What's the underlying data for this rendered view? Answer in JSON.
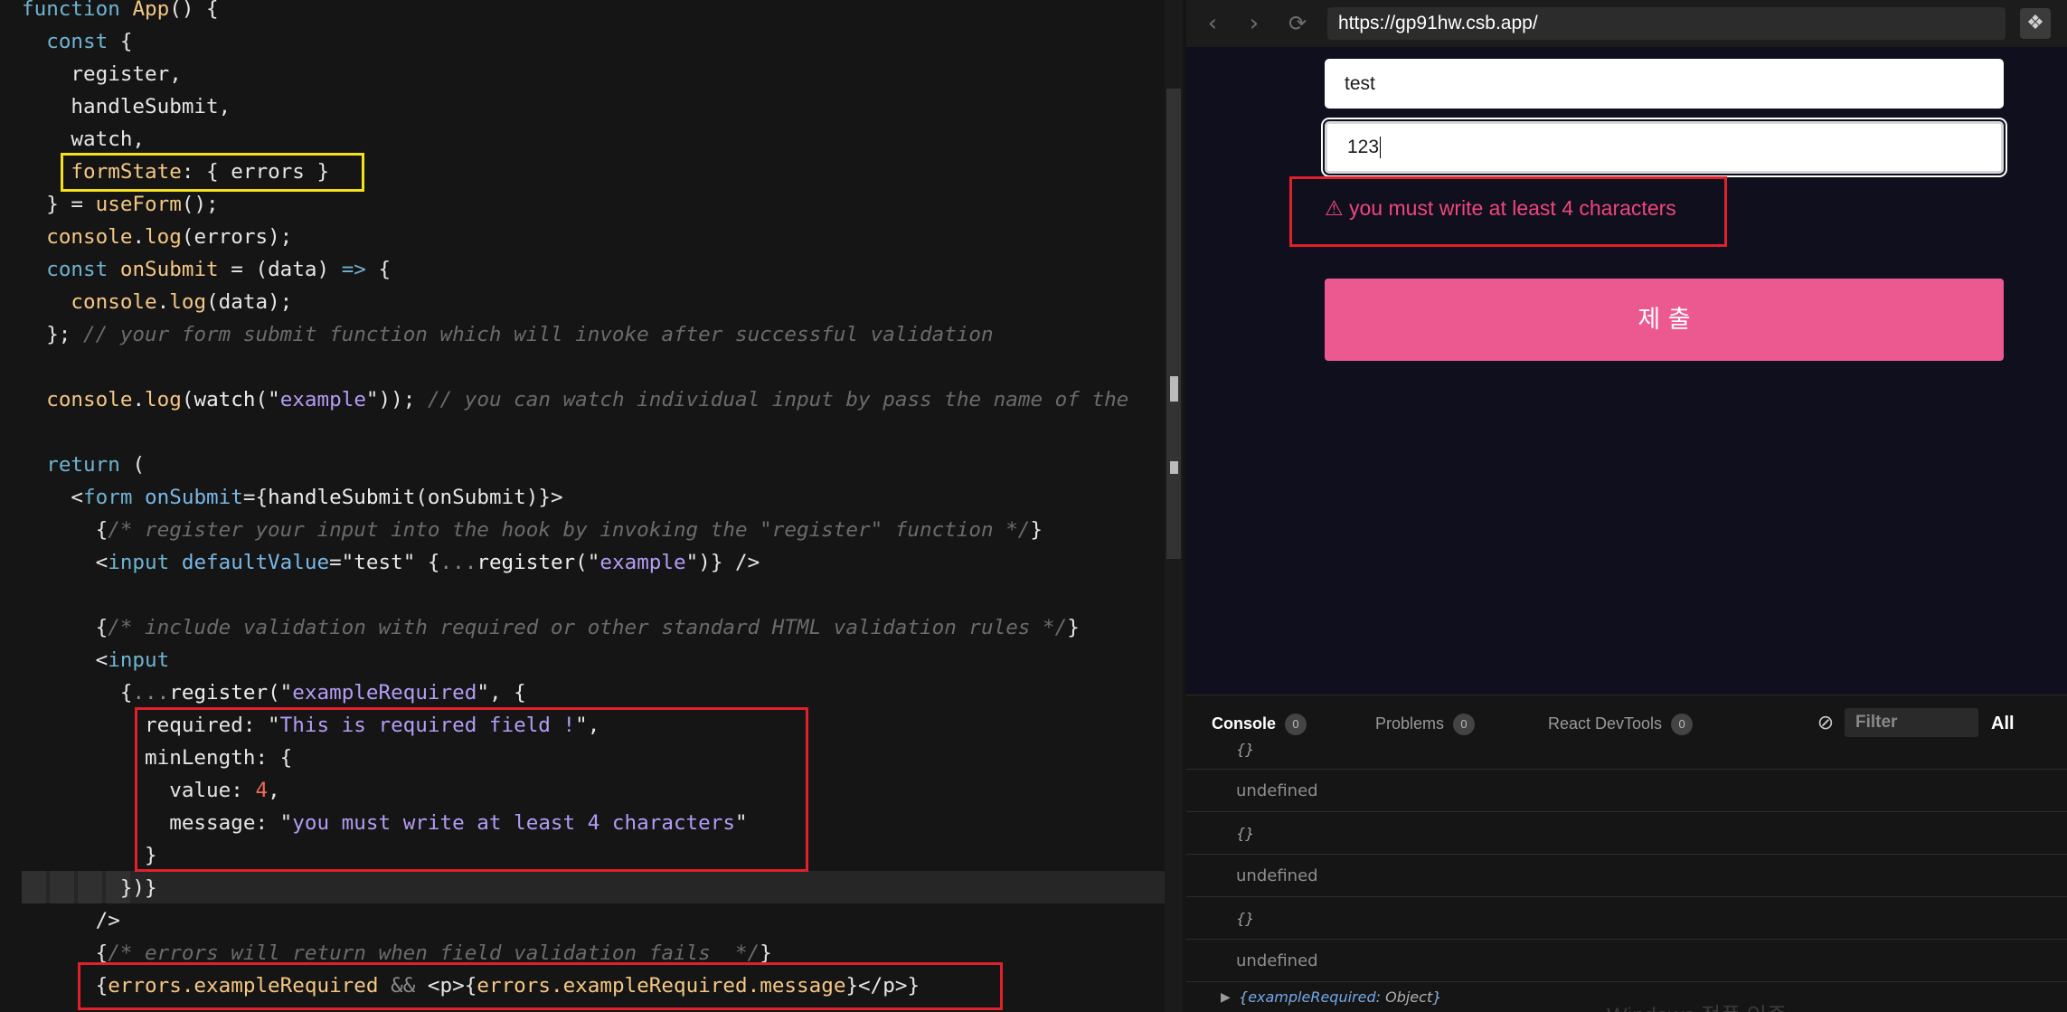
{
  "editor": {
    "lines": [
      [
        [
          "kw",
          "function"
        ],
        [
          "pl",
          " "
        ],
        [
          "fn",
          "App"
        ],
        [
          "pl",
          "() {"
        ]
      ],
      [
        [
          "pl",
          "  "
        ],
        [
          "kw",
          "const"
        ],
        [
          "pl",
          " {"
        ]
      ],
      [
        [
          "pl",
          "    register,"
        ]
      ],
      [
        [
          "pl",
          "    handleSubmit,"
        ]
      ],
      [
        [
          "pl",
          "    watch,"
        ]
      ],
      [
        [
          "pl",
          "    "
        ],
        [
          "fn",
          "formState"
        ],
        [
          "pl",
          ": { errors }"
        ]
      ],
      [
        [
          "pl",
          "  } = "
        ],
        [
          "fn",
          "useForm"
        ],
        [
          "pl",
          "();"
        ]
      ],
      [
        [
          "pl",
          "  "
        ],
        [
          "fn",
          "console"
        ],
        [
          "pl",
          "."
        ],
        [
          "fn",
          "log"
        ],
        [
          "pl",
          "(errors);"
        ]
      ],
      [
        [
          "pl",
          "  "
        ],
        [
          "kw",
          "const"
        ],
        [
          "pl",
          " "
        ],
        [
          "fn",
          "onSubmit"
        ],
        [
          "pl",
          " = (data) "
        ],
        [
          "kw",
          "=>"
        ],
        [
          "pl",
          " {"
        ]
      ],
      [
        [
          "pl",
          "    "
        ],
        [
          "fn",
          "console"
        ],
        [
          "pl",
          "."
        ],
        [
          "fn",
          "log"
        ],
        [
          "pl",
          "(data);"
        ]
      ],
      [
        [
          "pl",
          "  };"
        ],
        [
          "cm",
          " // your form submit function which will invoke after successful validation"
        ]
      ],
      [
        [
          "pl",
          ""
        ]
      ],
      [
        [
          "pl",
          "  "
        ],
        [
          "fn",
          "console"
        ],
        [
          "pl",
          "."
        ],
        [
          "fn",
          "log"
        ],
        [
          "pl",
          "("
        ],
        [
          "fnw",
          "watch"
        ],
        [
          "pl",
          "(\""
        ],
        [
          "st",
          "example"
        ],
        [
          "pl",
          "\")); "
        ],
        [
          "cm",
          "// you can watch individual input by pass the name of the"
        ]
      ],
      [
        [
          "pl",
          ""
        ]
      ],
      [
        [
          "pl",
          "  "
        ],
        [
          "kw",
          "return"
        ],
        [
          "pl",
          " ("
        ]
      ],
      [
        [
          "pl",
          "    <"
        ],
        [
          "tg",
          "form"
        ],
        [
          "pl",
          " "
        ],
        [
          "at",
          "onSubmit"
        ],
        [
          "pl",
          "={"
        ],
        [
          "fnw",
          "handleSubmit"
        ],
        [
          "pl",
          "(onSubmit)}>"
        ]
      ],
      [
        [
          "pl",
          "      {"
        ],
        [
          "cm",
          "/* register your input into the hook by invoking the \"register\" function */"
        ],
        [
          "pl",
          "}"
        ]
      ],
      [
        [
          "pl",
          "      <"
        ],
        [
          "tg",
          "input"
        ],
        [
          "pl",
          " "
        ],
        [
          "at",
          "defaultValue"
        ],
        [
          "pl",
          "=\""
        ],
        [
          "pl",
          "test"
        ],
        [
          "pl",
          "\" {"
        ],
        [
          "dim",
          "..."
        ],
        [
          "fnw",
          "register"
        ],
        [
          "pl",
          "(\""
        ],
        [
          "st",
          "example"
        ],
        [
          "pl",
          "\")} />"
        ]
      ],
      [
        [
          "pl",
          ""
        ]
      ],
      [
        [
          "pl",
          "      {"
        ],
        [
          "cm",
          "/* include validation with required or other standard HTML validation rules */"
        ],
        [
          "pl",
          "}"
        ]
      ],
      [
        [
          "pl",
          "      <"
        ],
        [
          "tg",
          "input"
        ]
      ],
      [
        [
          "pl",
          "        {"
        ],
        [
          "dim",
          "..."
        ],
        [
          "fnw",
          "register"
        ],
        [
          "pl",
          "(\""
        ],
        [
          "st",
          "exampleRequired"
        ],
        [
          "pl",
          "\", {"
        ]
      ],
      [
        [
          "pl",
          "          required: \""
        ],
        [
          "st",
          "This is required field !"
        ],
        [
          "pl",
          "\","
        ]
      ],
      [
        [
          "pl",
          "          minLength: {"
        ]
      ],
      [
        [
          "pl",
          "            value: "
        ],
        [
          "nm",
          "4"
        ],
        [
          "pl",
          ","
        ]
      ],
      [
        [
          "pl",
          "            message: \""
        ],
        [
          "st",
          "you must write at least 4 characters"
        ],
        [
          "pl",
          "\""
        ]
      ],
      [
        [
          "pl",
          "          }"
        ]
      ],
      [
        [
          "pl",
          "        })}"
        ]
      ],
      [
        [
          "pl",
          "      />"
        ]
      ],
      [
        [
          "pl",
          "      {"
        ],
        [
          "cm",
          "/* errors will return when field validation fails  */"
        ],
        [
          "pl",
          "}"
        ]
      ],
      [
        [
          "pl",
          "      {"
        ],
        [
          "fn",
          "errors.exampleRequired"
        ],
        [
          "pl",
          " "
        ],
        [
          "dim",
          "&&"
        ],
        [
          "pl",
          " <"
        ],
        [
          "pl",
          "p"
        ],
        [
          "pl",
          ">{"
        ],
        [
          "fn",
          "errors.exampleRequired.message"
        ],
        [
          "pl",
          "}</"
        ],
        [
          "pl",
          "p"
        ],
        [
          "pl",
          ">}"
        ]
      ]
    ]
  },
  "browser": {
    "url": "https://gp91hw.csb.app/",
    "back_icon": "arrow-left-icon",
    "forward_icon": "arrow-right-icon",
    "reload_icon": "reload-icon",
    "extension_icon": "sandbox-cube-icon",
    "form": {
      "example_value": "test",
      "required_value": "123",
      "error_text": "⚠ you must write at least 4 characters",
      "submit_label": "제 출"
    }
  },
  "console": {
    "tabs": [
      {
        "label": "Console",
        "count": "0"
      },
      {
        "label": "Problems",
        "count": "0"
      },
      {
        "label": "React DevTools",
        "count": "0"
      }
    ],
    "filter_placeholder": "Filter",
    "level": "All",
    "logs": [
      "{}",
      "undefined",
      "{}",
      "undefined",
      "{}",
      "undefined"
    ],
    "last_log_key": "exampleRequired",
    "last_log_value": "Object",
    "watermark": "Windows 정품 인증"
  },
  "colors": {
    "highlight_yellow": "#f5e11b",
    "highlight_red": "#e0202a",
    "submit_pink": "#ec5990",
    "error_pink": "#f0467c"
  }
}
